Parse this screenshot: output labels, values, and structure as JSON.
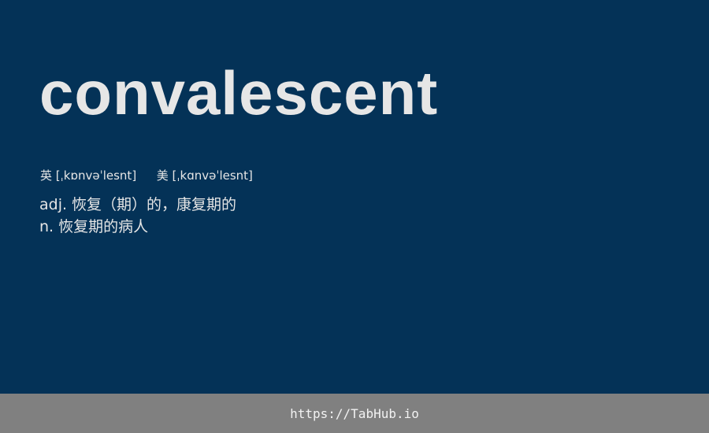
{
  "word": "convalescent",
  "phonetics": {
    "uk_label": "英",
    "uk_ipa": "[ˌkɒnvəˈlesnt]",
    "us_label": "美",
    "us_ipa": "[ˌkɑnvəˈlesnt]"
  },
  "definitions": [
    "adj. 恢复（期）的，康复期的",
    "n. 恢复期的病人"
  ],
  "footer": {
    "link_text": "https://TabHub.io"
  },
  "colors": {
    "background": "#043257",
    "text": "#e6e6e6",
    "footer_bar": "#808080"
  }
}
